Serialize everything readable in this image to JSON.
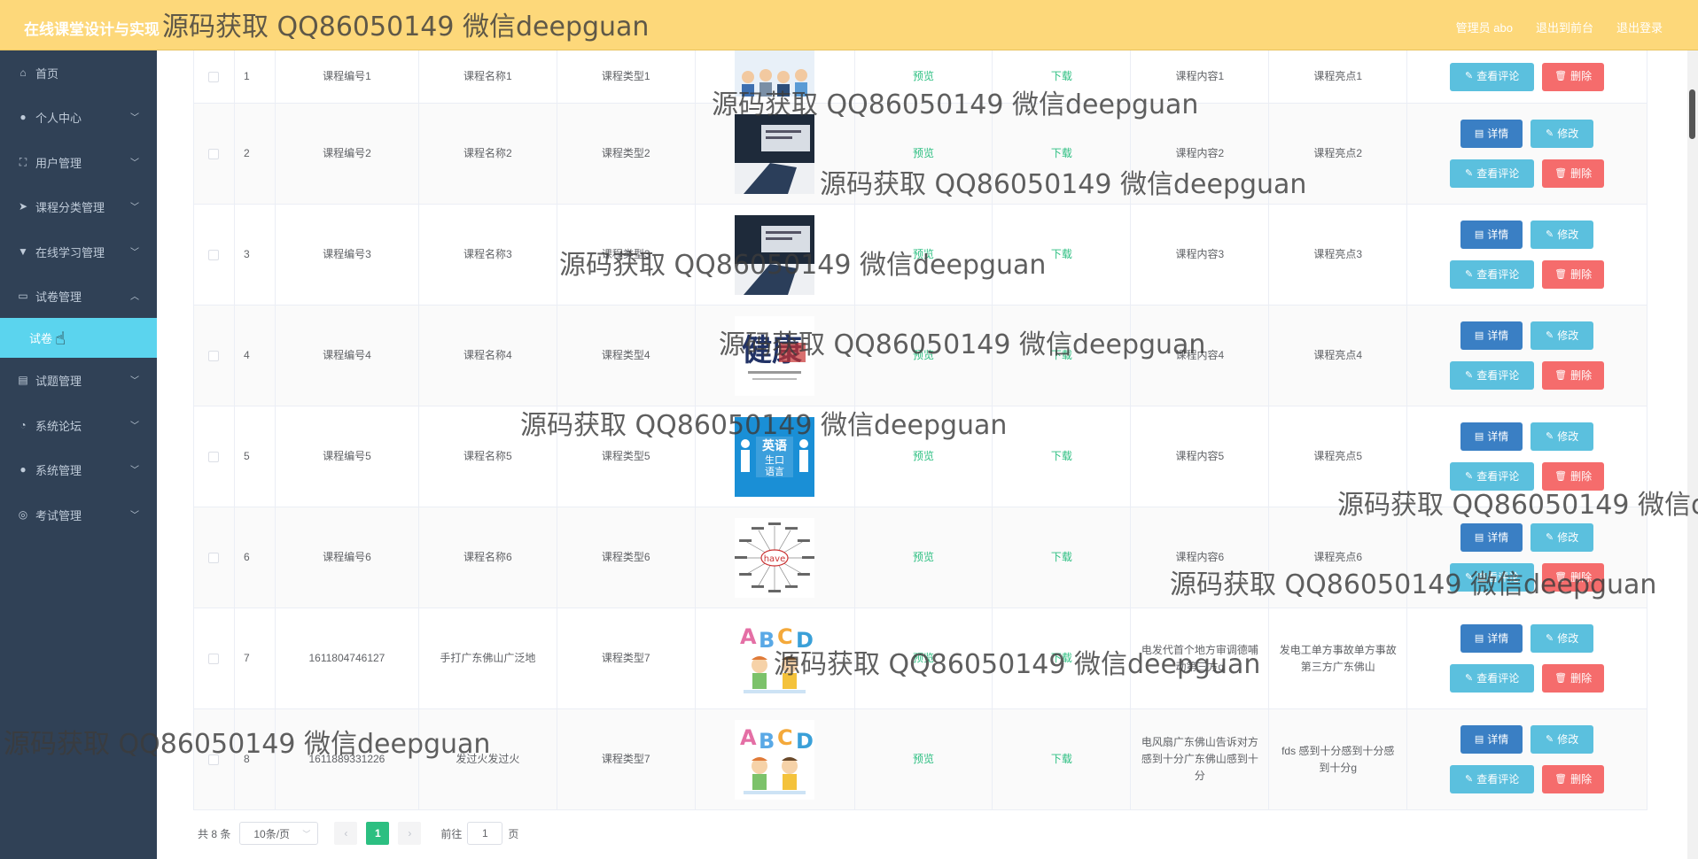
{
  "header": {
    "app_title": "在线课堂设计与实现",
    "admin_label": "管理员 abo",
    "back_link": "退出到前台",
    "logout_link": "退出登录"
  },
  "sidebar": {
    "items": [
      {
        "label": "首页",
        "icon": "home-icon",
        "chevron": false
      },
      {
        "label": "个人中心",
        "icon": "user-icon",
        "chevron": true
      },
      {
        "label": "用户管理",
        "icon": "frame-icon",
        "chevron": true
      },
      {
        "label": "课程分类管理",
        "icon": "send-icon",
        "chevron": true
      },
      {
        "label": "在线学习管理",
        "icon": "cup-icon",
        "chevron": true
      },
      {
        "label": "试卷管理",
        "icon": "chat-icon",
        "chevron": true,
        "expanded": true
      },
      {
        "label": "试题管理",
        "icon": "id-card-icon",
        "chevron": true
      },
      {
        "label": "系统论坛",
        "icon": "compass-icon",
        "chevron": true
      },
      {
        "label": "系统管理",
        "icon": "user-icon",
        "chevron": true
      },
      {
        "label": "考试管理",
        "icon": "globe-icon",
        "chevron": true
      }
    ],
    "active_sub": "试卷"
  },
  "table": {
    "preview_label": "预览",
    "download_label": "下载",
    "rows": [
      {
        "idx": "1",
        "code": "课程编号1",
        "name": "课程名称1",
        "type": "课程类型1",
        "content": "课程内容1",
        "highlight": "课程亮点1",
        "thumb": "people"
      },
      {
        "idx": "2",
        "code": "课程编号2",
        "name": "课程名称2",
        "type": "课程类型2",
        "content": "课程内容2",
        "highlight": "课程亮点2",
        "thumb": "study"
      },
      {
        "idx": "3",
        "code": "课程编号3",
        "name": "课程名称3",
        "type": "课程类型3",
        "content": "课程内容3",
        "highlight": "课程亮点3",
        "thumb": "study"
      },
      {
        "idx": "4",
        "code": "课程编号4",
        "name": "课程名称4",
        "type": "课程类型4",
        "content": "课程内容4",
        "highlight": "课程亮点4",
        "thumb": "calligraphy"
      },
      {
        "idx": "5",
        "code": "课程编号5",
        "name": "课程名称5",
        "type": "课程类型5",
        "content": "课程内容5",
        "highlight": "课程亮点5",
        "thumb": "english"
      },
      {
        "idx": "6",
        "code": "课程编号6",
        "name": "课程名称6",
        "type": "课程类型6",
        "content": "课程内容6",
        "highlight": "课程亮点6",
        "thumb": "mindmap"
      },
      {
        "idx": "7",
        "code": "1611804746127",
        "name": "手打广东佛山广泛地",
        "type": "课程类型7",
        "content": "电发代首个地方审调德哺动第三方g",
        "highlight": "发电工单方事故单方事故第三方广东佛山",
        "thumb": "abcd"
      },
      {
        "idx": "8",
        "code": "1611889331226",
        "name": "发过火发过火",
        "type": "课程类型7",
        "content": "电风扇广东佛山告诉对方感到十分广东佛山感到十分",
        "highlight": "fds 感到十分感到十分感到十分g",
        "thumb": "abcd"
      }
    ],
    "buttons": {
      "detail": "详情",
      "edit": "修改",
      "comment": "查看评论",
      "delete": "删除"
    },
    "thumb_text": {
      "calligraphy": "健康",
      "english_line1": "英语",
      "english_line2": "生口",
      "english_line3": "语言",
      "mindmap": "have",
      "abcd": [
        "A",
        "B",
        "C",
        "D"
      ]
    }
  },
  "pagination": {
    "total": "共 8 条",
    "page_size": "10条/页",
    "current_page": "1",
    "goto_prefix": "前往",
    "goto_value": "1",
    "goto_suffix": "页"
  },
  "watermark": {
    "text": "源码获取 QQ86050149 微信deepguan",
    "text_cut": "源码获取 QQ86050149 微信d"
  },
  "colors": {
    "header_bg": "#fdd87a",
    "sidebar_bg": "#304156",
    "active_sub_bg": "#5bd4ee",
    "link_green": "#2cbf81",
    "detail_blue": "#3a7fc4",
    "light_blue": "#5bc0de",
    "delete_red": "#f56c6c"
  }
}
